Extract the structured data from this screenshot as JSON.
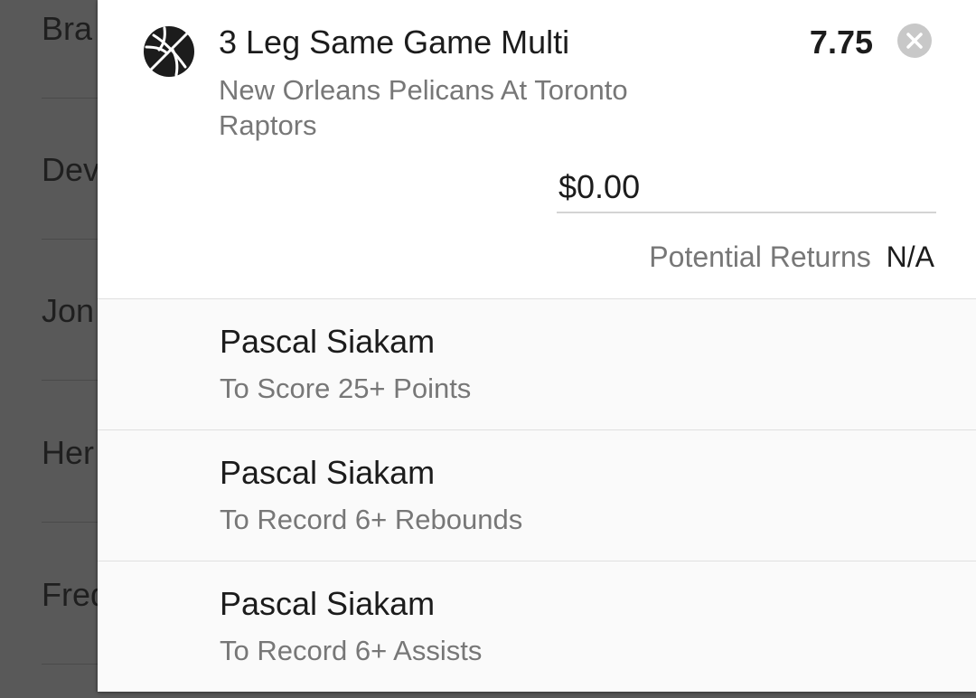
{
  "background_list": {
    "items": [
      {
        "label": "Bra"
      },
      {
        "label": "Dev"
      },
      {
        "label": "Jon"
      },
      {
        "label": "Her"
      },
      {
        "label": "Fred"
      }
    ]
  },
  "bet": {
    "icon": "basketball-icon",
    "title": "3 Leg Same Game Multi",
    "odds": "7.75",
    "close_icon": "close-circle-icon",
    "event": "New Orleans Pelicans At Toronto Raptors",
    "stake_value": "$0.00",
    "returns_label": "Potential Returns",
    "returns_value": "N/A"
  },
  "legs": [
    {
      "player": "Pascal Siakam",
      "market": "To Score 25+ Points"
    },
    {
      "player": "Pascal Siakam",
      "market": "To Record 6+ Rebounds"
    },
    {
      "player": "Pascal Siakam",
      "market": "To Record 6+ Assists"
    }
  ]
}
